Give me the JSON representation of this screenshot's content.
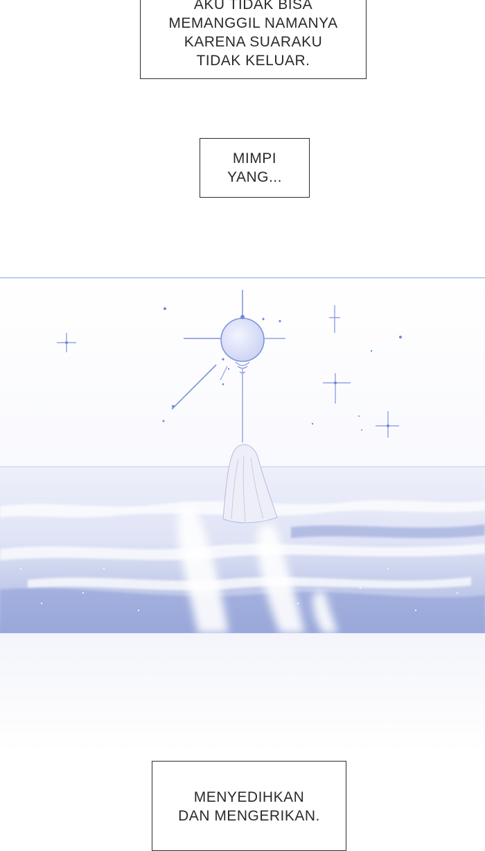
{
  "captions": {
    "first": {
      "lines": [
        "AKU TIDAK BISA",
        "MEMANGGIL NAMANYA",
        "KARENA SUARAKU",
        "TIDAK KELUAR."
      ]
    },
    "second": {
      "lines": [
        "MIMPI",
        "YANG..."
      ]
    },
    "third": {
      "lines": [
        "MENYEDIHKAN",
        "DAN MENGERIKAN."
      ]
    }
  },
  "illustration": {
    "scene": "dream-sea-with-star-orb",
    "colors": {
      "sky_top": "#f6f7fd",
      "orb": "#dfe4f9",
      "accent": "#6e86d6",
      "sea_light": "#e6e9f7",
      "sea_deep": "#9aa9da",
      "border": "#8eb1e6"
    }
  }
}
